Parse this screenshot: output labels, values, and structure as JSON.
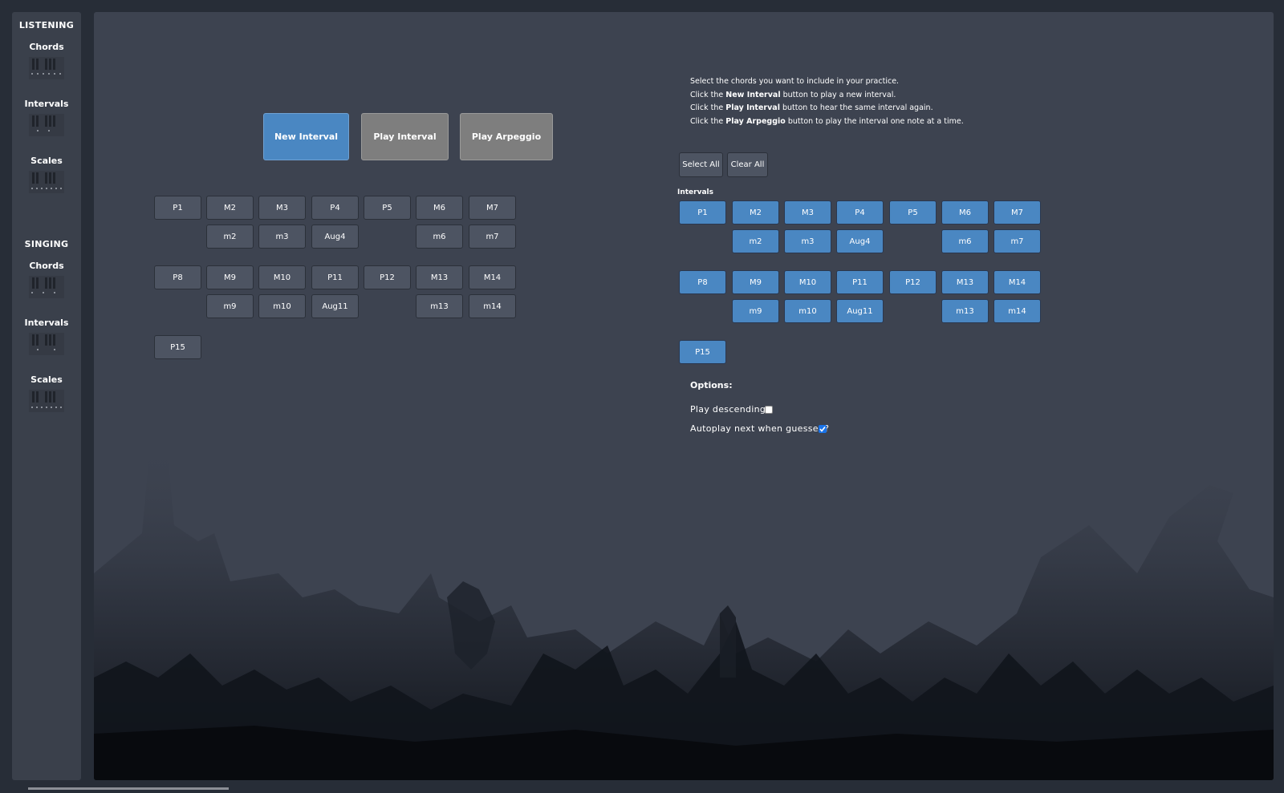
{
  "sidebar": {
    "listening": {
      "title": "LISTENING",
      "items": [
        {
          "label": "Chords",
          "icon": "piano-keys-icon"
        },
        {
          "label": "Intervals",
          "icon": "piano-keys-icon"
        },
        {
          "label": "Scales",
          "icon": "piano-keys-icon"
        }
      ]
    },
    "singing": {
      "title": "SINGING",
      "items": [
        {
          "label": "Chords",
          "icon": "piano-keys-icon"
        },
        {
          "label": "Intervals",
          "icon": "piano-keys-icon"
        },
        {
          "label": "Scales",
          "icon": "piano-keys-icon"
        }
      ]
    }
  },
  "controls": {
    "new_interval": "New Interval",
    "play_interval": "Play Interval",
    "play_arpeggio": "Play Arpeggio"
  },
  "answer_grid": {
    "row1": [
      "P1",
      "M2",
      "M3",
      "P4",
      "P5",
      "M6",
      "M7"
    ],
    "row2": [
      "m2",
      "m3",
      "Aug4",
      "m6",
      "m7"
    ],
    "row3": [
      "P8",
      "M9",
      "M10",
      "P11",
      "P12",
      "M13",
      "M14"
    ],
    "row4": [
      "m9",
      "m10",
      "Aug11",
      "m13",
      "m14"
    ],
    "row5": [
      "P15"
    ]
  },
  "instructions": {
    "line1": "Select the chords you want to include in your practice.",
    "line2_pre": "Click the ",
    "line2_bold": "New Interval",
    "line2_post": " button to play a new interval.",
    "line3_pre": "Click the ",
    "line3_bold": "Play Interval",
    "line3_post": " button to hear the same interval again.",
    "line4_pre": "Click the ",
    "line4_bold": "Play Arpeggio",
    "line4_post": " button to play the interval one note at a time."
  },
  "selection": {
    "select_all": "Select All",
    "clear_all": "Clear All",
    "intervals_heading": "Intervals",
    "row1": [
      "P1",
      "M2",
      "M3",
      "P4",
      "P5",
      "M6",
      "M7"
    ],
    "row2": [
      "m2",
      "m3",
      "Aug4",
      "m6",
      "m7"
    ],
    "row3": [
      "P8",
      "M9",
      "M10",
      "P11",
      "P12",
      "M13",
      "M14"
    ],
    "row4": [
      "m9",
      "m10",
      "Aug11",
      "m13",
      "m14"
    ],
    "row5": [
      "P15"
    ]
  },
  "options": {
    "heading": "Options:",
    "play_descending": {
      "label": "Play descending?",
      "checked": false
    },
    "autoplay": {
      "label": "Autoplay next when guessed?",
      "checked": true
    }
  },
  "colors": {
    "accent_blue": "#4a87c2",
    "button_gray": "#7e7e7e",
    "panel": "#3d4350",
    "background": "#272d37"
  }
}
